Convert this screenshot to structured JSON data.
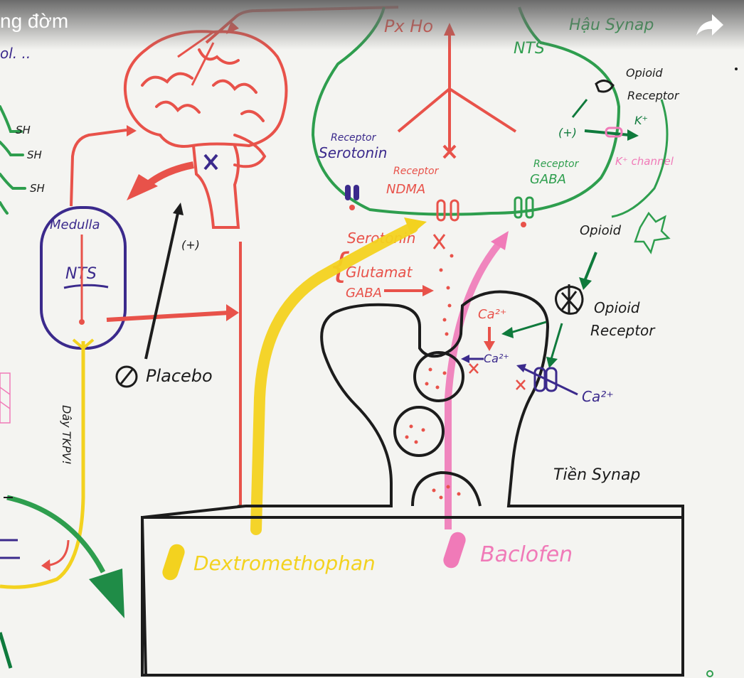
{
  "player": {
    "title_fragment": "ng đờm",
    "share_icon": "share-arrow-icon"
  },
  "diagram": {
    "top_left_fragment": "ol. ..",
    "sh_labels": [
      "SH",
      "SH",
      "SH"
    ],
    "medulla": "Medulla",
    "nts_left": "NTS",
    "placebo": "Placebo",
    "plus_sign": "(+)",
    "nerve_label": "Dây TKPV!",
    "px_ho": "Px Ho",
    "hau_synap": "Hậu Synap",
    "nts_right": "NTS",
    "receptor_serotonin_small": "Receptor",
    "receptor_serotonin": "Serotonin",
    "receptor_ndma_small": "Receptor",
    "receptor_ndma": "NDMA",
    "receptor_gaba_small": "Receptor",
    "receptor_gaba": "GABA",
    "opioid_receptor_top_1": "Opioid",
    "opioid_receptor_top_2": "Receptor",
    "plus_green": "(+)",
    "k_plus": "K⁺",
    "k_channel": "K⁺ channel",
    "serotonin": "Serotonin",
    "glutamat": "Glutamat",
    "gaba": "GABA",
    "opioid": "Opioid",
    "opioid_receptor_1": "Opioid",
    "opioid_receptor_2": "Receptor",
    "ca_top": "Ca²⁺",
    "ca_mid": "Ca²⁺",
    "ca_bottom": "Ca²⁺",
    "tien_synap": "Tiền Synap",
    "dextromethophan": "Dextromethophan",
    "baclofen": "Baclofen"
  },
  "colors": {
    "red": "#e8524a",
    "green": "#2e9e4e",
    "dark_green": "#0f7a3c",
    "purple": "#3b2a8c",
    "yellow": "#f3d21f",
    "pink": "#f07ab8",
    "black": "#1c1c1c"
  }
}
